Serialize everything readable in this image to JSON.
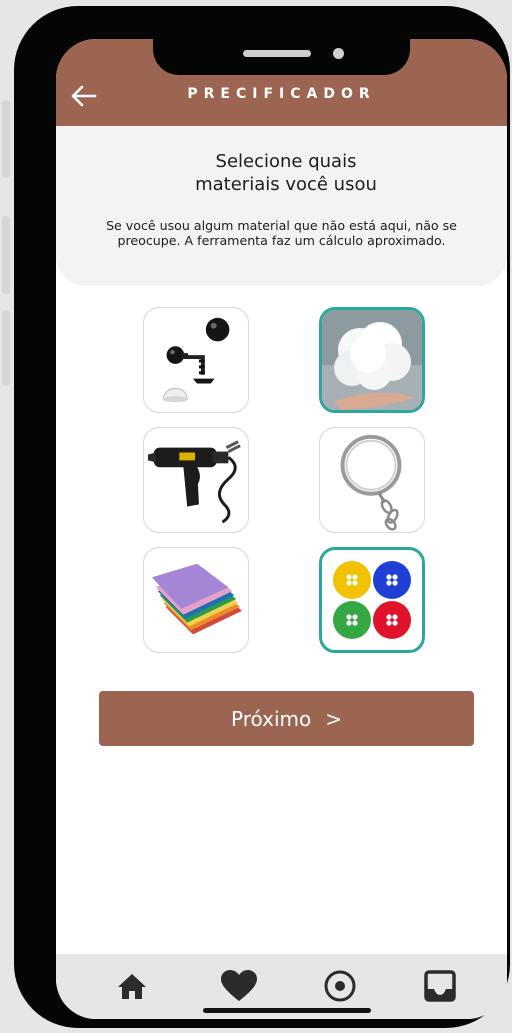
{
  "header": {
    "title": "PRECIFICADOR",
    "back_icon": "arrow-left-icon"
  },
  "intro": {
    "heading": "Selecione quais\nmateriais você usou",
    "note": "Se você usou algum material que não está aqui, não se preocupe. A ferramenta faz um cálculo aproximado."
  },
  "materials": [
    {
      "icon": "safety-eyes-icon",
      "selected": false
    },
    {
      "icon": "fiber-stuffing-icon",
      "selected": true
    },
    {
      "icon": "hot-glue-gun-icon",
      "selected": false
    },
    {
      "icon": "keyring-icon",
      "selected": false
    },
    {
      "icon": "felt-sheets-icon",
      "selected": false
    },
    {
      "icon": "buttons-icon",
      "selected": true
    }
  ],
  "next_button": {
    "label": "Próximo",
    "chevron": ">"
  },
  "tabbar": {
    "items": [
      "home-icon",
      "heart-icon",
      "record-icon",
      "inbox-icon"
    ]
  },
  "colors": {
    "brand": "#9c6551",
    "selected_border": "#2aa899",
    "tabbar_bg": "#e6e6e6"
  }
}
